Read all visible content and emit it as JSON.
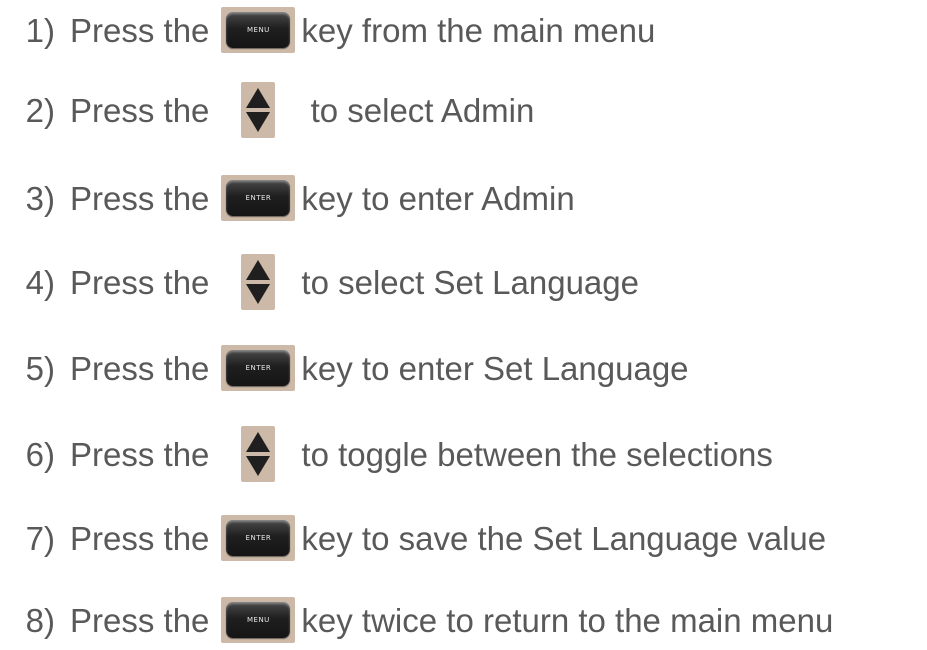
{
  "steps": [
    {
      "number": "1)",
      "prefix": "Press the",
      "key": "menu-key",
      "key_label": "MENU",
      "suffix": "key from the main menu"
    },
    {
      "number": "2)",
      "prefix": "Press the",
      "key": "up-down-arrow-key",
      "key_label": "",
      "suffix": " to select Admin"
    },
    {
      "number": "3)",
      "prefix": "Press the",
      "key": "enter-key",
      "key_label": "ENTER",
      "suffix": "key to enter Admin"
    },
    {
      "number": "4)",
      "prefix": "Press the",
      "key": "up-down-arrow-key",
      "key_label": "",
      "suffix": "to select Set Language"
    },
    {
      "number": "5)",
      "prefix": "Press the",
      "key": "enter-key",
      "key_label": "ENTER",
      "suffix": "key to enter Set Language"
    },
    {
      "number": "6)",
      "prefix": "Press the",
      "key": "up-down-arrow-key",
      "key_label": "",
      "suffix": "to toggle between the selections"
    },
    {
      "number": "7)",
      "prefix": "Press the",
      "key": "enter-key",
      "key_label": "ENTER",
      "suffix": "key to save the Set Language value"
    },
    {
      "number": "8)",
      "prefix": "Press the",
      "key": "menu-key",
      "key_label": "MENU",
      "suffix": "key twice to return to the main menu"
    }
  ],
  "colors": {
    "text": "#595959",
    "key_background": "#cdb9a8",
    "key_cap": "#1f1f1f"
  }
}
